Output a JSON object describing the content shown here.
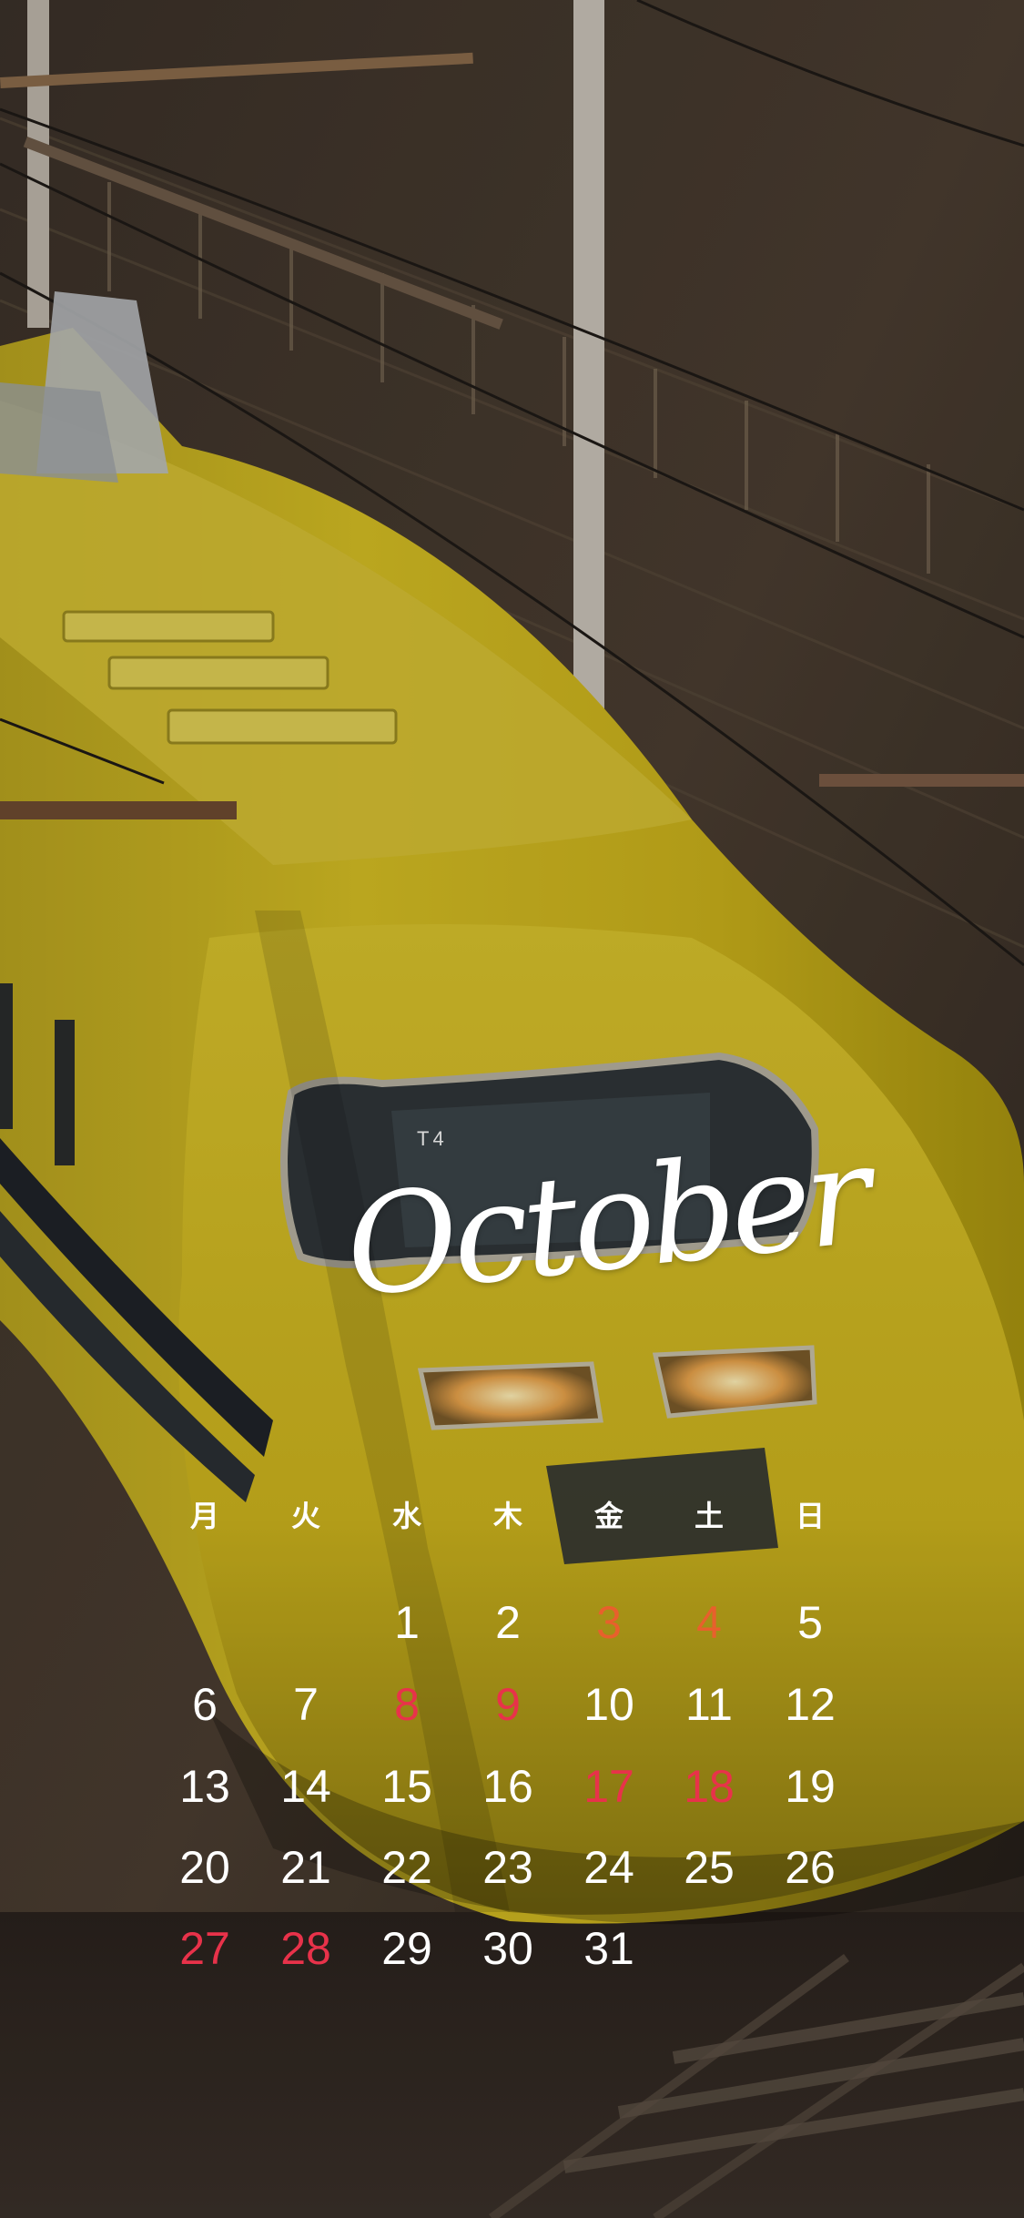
{
  "calendar": {
    "month": "October",
    "weekdays": [
      "月",
      "火",
      "水",
      "木",
      "金",
      "土",
      "日"
    ],
    "weeks": [
      [
        "",
        "",
        "1",
        "2",
        "3",
        "4",
        "5"
      ],
      [
        "6",
        "7",
        "8",
        "9",
        "10",
        "11",
        "12"
      ],
      [
        "13",
        "14",
        "15",
        "16",
        "17",
        "18",
        "19"
      ],
      [
        "20",
        "21",
        "22",
        "23",
        "24",
        "25",
        "26"
      ],
      [
        "27",
        "28",
        "29",
        "30",
        "31",
        "",
        ""
      ]
    ],
    "colors": {
      "weekday_text": "#ffffff",
      "holiday_red": "#e8324a",
      "weekend_orange": "#e8602c"
    }
  },
  "photo": {
    "train_number": "T4"
  }
}
